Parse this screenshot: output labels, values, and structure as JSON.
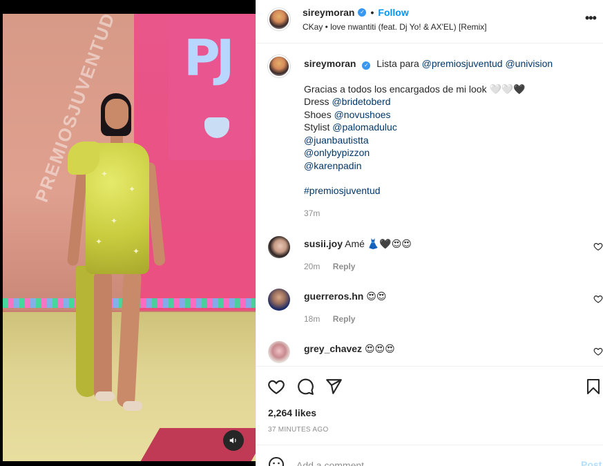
{
  "header": {
    "username": "sireymoran",
    "separator": "•",
    "follow_label": "Follow",
    "audio": "CKay • love nwantiti (feat. Dj Yo! & AX'EL) [Remix]",
    "more_label": "•••"
  },
  "media": {
    "sign_text": "PREMIOSJUVENTUD",
    "logo_text": "PJ"
  },
  "caption": {
    "username": "sireymoran",
    "text_intro": "Lista para",
    "mentions_intro": [
      "@premiosjuventud",
      "@univision"
    ],
    "line1": "Gracias a todos los encargados de mi look 🤍🤍🖤",
    "dress_label": "Dress",
    "dress_mention": "@bridetoberd",
    "shoes_label": "Shoes",
    "shoes_mention": "@novushoes",
    "stylist_label": "Stylist",
    "stylist_mention": "@palomaduluc",
    "extra_mentions": [
      "@juanbautistta",
      "@onlybypizzon",
      "@karenpadin"
    ],
    "hashtag": "#premiosjuventud",
    "time": "37m"
  },
  "comments": [
    {
      "username": "susii.joy",
      "text": "Amé 👗🖤😍😍",
      "time": "20m",
      "reply": "Reply"
    },
    {
      "username": "guerreros.hn",
      "text": "😍😍",
      "time": "18m",
      "reply": "Reply"
    },
    {
      "username": "grey_chavez",
      "text": "😍😍😍",
      "time": "",
      "reply": ""
    }
  ],
  "actions": {
    "likes": "2,264 likes",
    "time_ago": "37 MINUTES AGO",
    "comment_placeholder": "Add a comment...",
    "post_label": "Post"
  },
  "colors": {
    "link": "#0095f6",
    "mention": "#00376b",
    "muted": "#8e8e8e",
    "verified": "#3897f0"
  }
}
